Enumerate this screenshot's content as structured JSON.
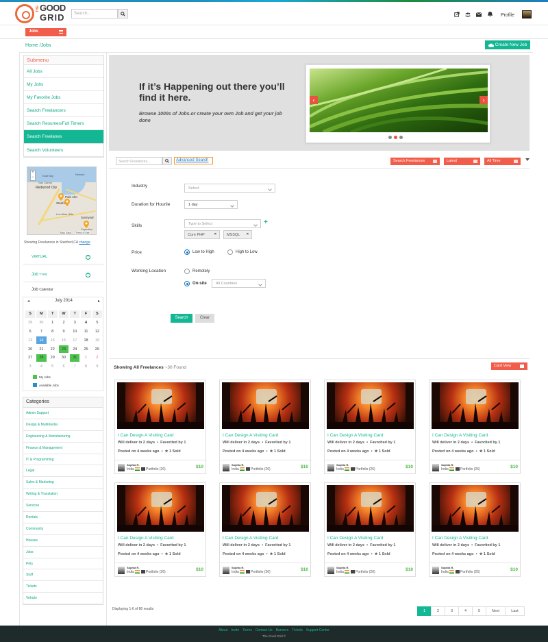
{
  "header": {
    "logo_the": "THE",
    "logo_good": "GOOD",
    "logo_grid": "GRID",
    "search_placeholder": "Search...",
    "profile_label": "Profile",
    "icons": [
      "external-link-icon",
      "users-icon",
      "envelope-icon",
      "bell-icon"
    ]
  },
  "jobs_menu": {
    "label": "Jobs"
  },
  "breadcrumb": {
    "text": "Home /Jobs"
  },
  "create_button": {
    "label": "Create New Job"
  },
  "submenu": {
    "title": "Submenu",
    "items": [
      {
        "label": "All Jobs",
        "active": false
      },
      {
        "label": "My Jobs",
        "active": false
      },
      {
        "label": "My Favorite Jobs",
        "active": false
      },
      {
        "label": "Search Freelancers",
        "active": false
      },
      {
        "label": "Search Resumes/Full Timers",
        "active": false
      },
      {
        "label": "Search Freelanes",
        "active": true
      },
      {
        "label": "Search Volunteers",
        "active": false
      }
    ]
  },
  "map": {
    "caption": "Showing Freelances in Stanford,CA",
    "change_link": "change",
    "labels": [
      "East Bay",
      "Newark",
      "San Carlos",
      "Redwood City",
      "Palo Alto",
      "Stanford",
      "Los Altos Hills",
      "Sunnyval",
      "Cupertino",
      "Map Data",
      "Terms of Use"
    ],
    "zoom_in": "+",
    "zoom_out": "−"
  },
  "sections": {
    "virtual": "VIRTUAL",
    "job_type_a": "Job",
    "job_type_b": "TYPE",
    "calendar_a": "Job",
    "calendar_b": "Calendar"
  },
  "calendar": {
    "month": "July 2014",
    "prev": "◂",
    "next": "▸",
    "dow": [
      "S",
      "M",
      "T",
      "W",
      "T",
      "F",
      "S"
    ],
    "days": [
      {
        "d": "29",
        "s": "muted"
      },
      {
        "d": "30",
        "s": "muted"
      },
      {
        "d": "1",
        "s": ""
      },
      {
        "d": "2",
        "s": ""
      },
      {
        "d": "3",
        "s": ""
      },
      {
        "d": "4",
        "s": "bold"
      },
      {
        "d": "5",
        "s": ""
      },
      {
        "d": "6",
        "s": ""
      },
      {
        "d": "7",
        "s": ""
      },
      {
        "d": "8",
        "s": ""
      },
      {
        "d": "9",
        "s": ""
      },
      {
        "d": "10",
        "s": ""
      },
      {
        "d": "11",
        "s": ""
      },
      {
        "d": "12",
        "s": ""
      },
      {
        "d": "13",
        "s": "muted"
      },
      {
        "d": "14",
        "s": "blue"
      },
      {
        "d": "15",
        "s": "muted"
      },
      {
        "d": "16",
        "s": "muted"
      },
      {
        "d": "17",
        "s": "muted"
      },
      {
        "d": "18",
        "s": ""
      },
      {
        "d": "19",
        "s": "muted"
      },
      {
        "d": "20",
        "s": ""
      },
      {
        "d": "21",
        "s": ""
      },
      {
        "d": "22",
        "s": ""
      },
      {
        "d": "23",
        "s": "green"
      },
      {
        "d": "24",
        "s": ""
      },
      {
        "d": "25",
        "s": ""
      },
      {
        "d": "26",
        "s": ""
      },
      {
        "d": "27",
        "s": ""
      },
      {
        "d": "28",
        "s": "green"
      },
      {
        "d": "29",
        "s": ""
      },
      {
        "d": "30",
        "s": ""
      },
      {
        "d": "31",
        "s": "green"
      },
      {
        "d": "1",
        "s": "red"
      },
      {
        "d": "2",
        "s": "red"
      },
      {
        "d": "3",
        "s": "muted"
      },
      {
        "d": "4",
        "s": "muted"
      },
      {
        "d": "5",
        "s": "muted"
      },
      {
        "d": "6",
        "s": "muted"
      },
      {
        "d": "7",
        "s": "muted"
      },
      {
        "d": "8",
        "s": "muted"
      },
      {
        "d": "9",
        "s": "muted"
      }
    ],
    "legend_my_jobs": "My Jobs",
    "legend_available": "Available Jobs",
    "colors": {
      "green": "#4ec24e",
      "blue": "#2a8fc9"
    }
  },
  "categories": {
    "title": "Categories",
    "items": [
      "Admin Support",
      "Design & Multimedia",
      "Engineering & Manufacturing",
      "Finance & Management",
      "IT & Programming",
      "Legal",
      "Sales & Marketing",
      "Writing & Translation",
      "Services",
      "Rentals",
      "Community",
      "Houses",
      "Jobs",
      "Pets",
      "Stuff",
      "Tickets",
      "Vehicle"
    ]
  },
  "banner": {
    "headline": "If it’s Happening out there you’ll find it here.",
    "subtext": "Browse 1000s of Jobs.or create your own Job and get your job done"
  },
  "filter": {
    "search_placeholder": "Search Freelances...",
    "advanced_link": "Advanced Search",
    "btn_type": "Search Freelances",
    "btn_sort": "Latest",
    "btn_time": "All Time"
  },
  "form": {
    "industry_label": "Industry",
    "industry_value": "Select",
    "duration_label": "Duration for Hourlie",
    "duration_value": "1 day",
    "skills_label": "Skills",
    "skills_placeholder": "Type to Select",
    "skill_tags": [
      "Core PHP",
      "MSSQL"
    ],
    "price_label": "Price",
    "price_low": "Low to High",
    "price_high": "High to Low",
    "location_label": "Working Location",
    "loc_remote": "Remotely",
    "loc_onsite": "On-site",
    "countries_value": "All Countries",
    "search_btn": "Search",
    "clear_btn": "Clear"
  },
  "results": {
    "showing_label": "Showing All Freelances",
    "found_text": "~30 Found",
    "card_view_btn": "Card View",
    "cards": [
      {
        "title": "I Can Design A Visiting Card",
        "deliver": "Will deliver in 2 days",
        "favorited": "Favorited by 1",
        "posted": "Posted on 4 weeks ago",
        "sold": "1 Sold",
        "name": "Sophia R.",
        "country": "India",
        "portfolio": "Portfolio (26)",
        "price": "$10"
      },
      {
        "title": "I Can Design A Visiting Card",
        "deliver": "Will deliver in 2 days",
        "favorited": "Favorited by 1",
        "posted": "Posted on 4 weeks ago",
        "sold": "1 Sold",
        "name": "Sophia R.",
        "country": "India",
        "portfolio": "Portfolio (26)",
        "price": "$10"
      },
      {
        "title": "I Can Design A Visiting Card",
        "deliver": "Will deliver in 2 days",
        "favorited": "Favorited by 1",
        "posted": "Posted on 4 weeks ago",
        "sold": "1 Sold",
        "name": "Sophia R.",
        "country": "India",
        "portfolio": "Portfolio (26)",
        "price": "$10"
      },
      {
        "title": "I Can Design A Visiting Card",
        "deliver": "Will deliver in 2 days",
        "favorited": "Favorited by 1",
        "posted": "Posted on 4 weeks ago",
        "sold": "1 Sold",
        "name": "Sophia R.",
        "country": "India",
        "portfolio": "Portfolio (26)",
        "price": "$10"
      },
      {
        "title": "I Can Design A Visiting Card",
        "deliver": "Will deliver in 2 days",
        "favorited": "Favorited by 1",
        "posted": "Posted on 4 weeks ago",
        "sold": "1 Sold",
        "name": "Sophia R.",
        "country": "India",
        "portfolio": "Portfolio (26)",
        "price": "$10"
      },
      {
        "title": "I Can Design A Visiting Card",
        "deliver": "Will deliver in 2 days",
        "favorited": "Favorited by 1",
        "posted": "Posted on 4 weeks ago",
        "sold": "1 Sold",
        "name": "Sophia R.",
        "country": "India",
        "portfolio": "Portfolio (26)",
        "price": "$10"
      },
      {
        "title": "I Can Design A Visiting Card",
        "deliver": "Will deliver in 2 days",
        "favorited": "Favorited by 1",
        "posted": "Posted on 4 weeks ago",
        "sold": "1 Sold",
        "name": "Sophia R.",
        "country": "India",
        "portfolio": "Portfolio (26)",
        "price": "$10"
      },
      {
        "title": "I Can Design A Visiting Card",
        "deliver": "Will deliver in 2 days",
        "favorited": "Favorited by 1",
        "posted": "Posted on 4 weeks ago",
        "sold": "1 Sold",
        "name": "Sophia R.",
        "country": "India",
        "portfolio": "Portfolio (26)",
        "price": "$10"
      }
    ],
    "displaying": "Displaying 1-6 of 86 results",
    "pages": [
      "1",
      "2",
      "3",
      "4",
      "5",
      "Next",
      "Last"
    ],
    "current_page": "1"
  },
  "footer": {
    "links": [
      "About",
      "Invite",
      "Terms",
      "Contact Us",
      "Banners",
      "Tickets",
      "Support Center"
    ],
    "copyright": "The Good Grid ©"
  },
  "colors": {
    "accent_teal": "#13b793",
    "accent_red": "#f25c4b",
    "link_blue": "#1a75c4",
    "footer_bg": "#1f2b2b"
  }
}
